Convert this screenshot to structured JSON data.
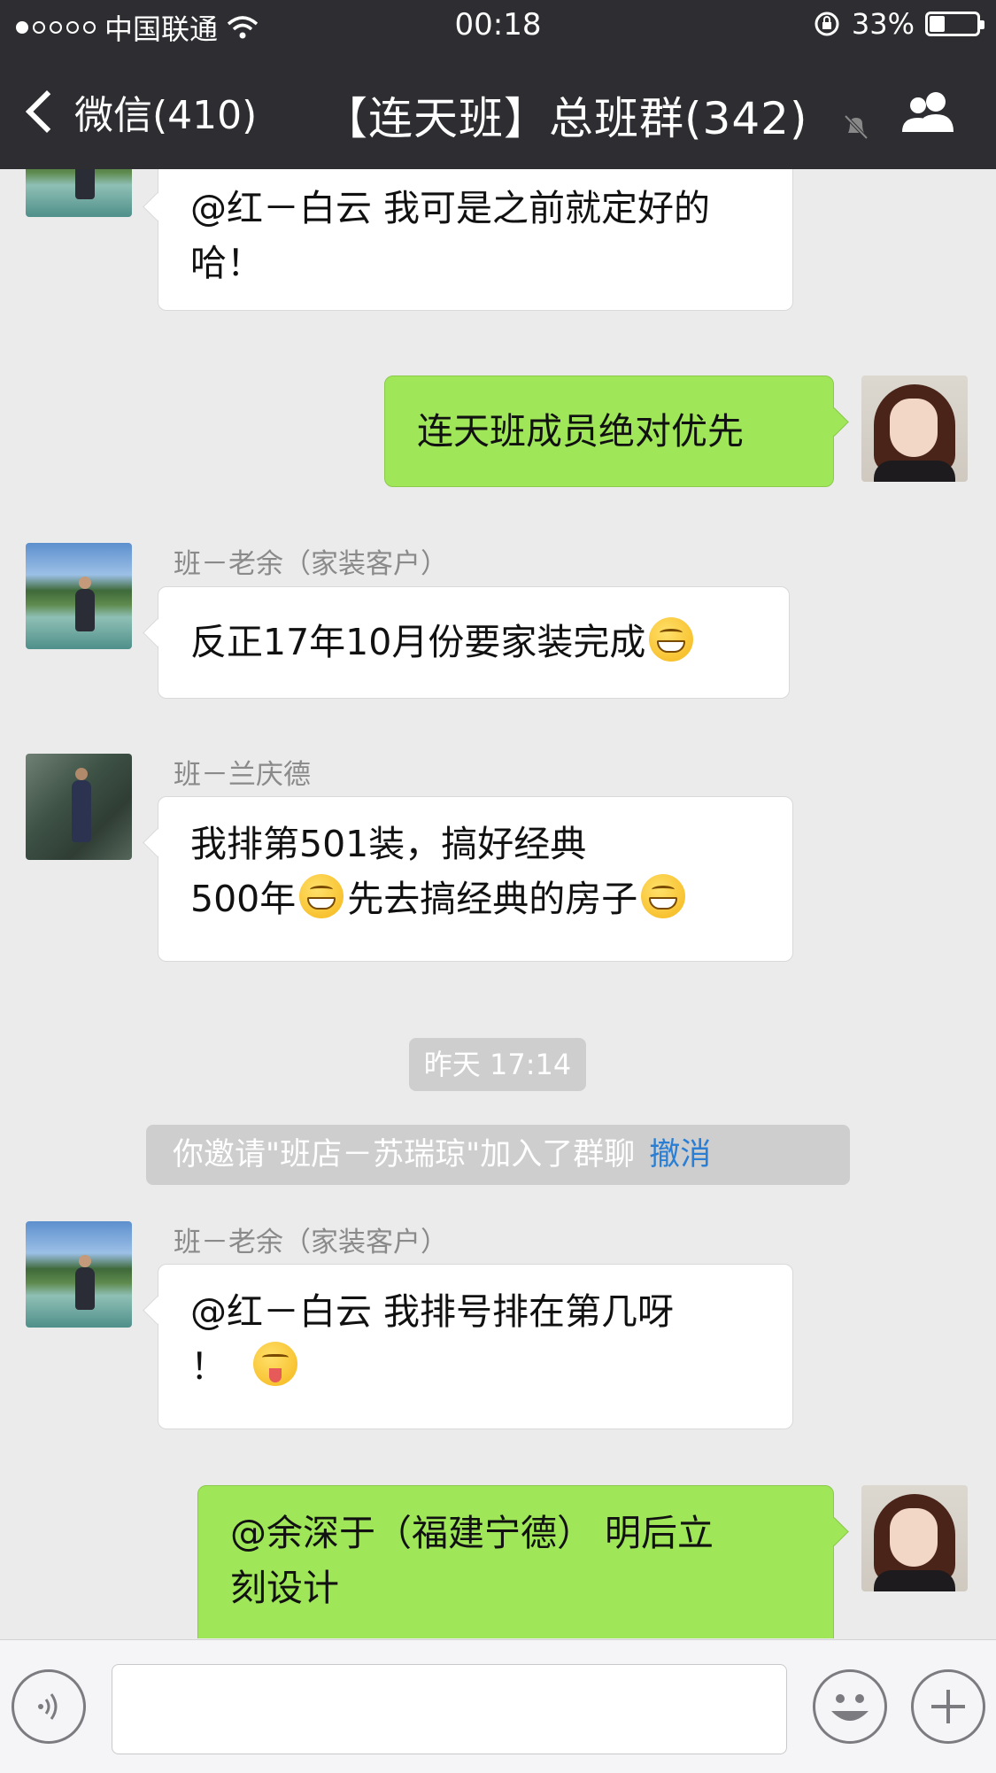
{
  "status_bar": {
    "carrier": "中国联通",
    "time": "00:18",
    "battery": "33%",
    "battery_level": 0.33
  },
  "nav": {
    "back_label": "微信(410)",
    "title": "【连天班】总班群(342)"
  },
  "messages": [
    {
      "side": "in",
      "sender": "",
      "text": "@红－白云 我可是之前就定好的哈！"
    },
    {
      "side": "out",
      "text": "连天班成员绝对优先"
    },
    {
      "side": "in",
      "sender": "班－老余（家装客户）",
      "text": "反正17年10月份要家装完成"
    },
    {
      "side": "in",
      "sender": "班－兰庆德",
      "text_line1": "我排第501装，搞好经典",
      "text_line2a": "500年",
      "text_line2b": "先去搞经典的房子"
    },
    {
      "side": "in",
      "sender": "班－老余（家装客户）",
      "text_line1": "@红－白云 我排号排在第几呀",
      "text_line2": "！"
    },
    {
      "side": "out",
      "text_line1": "@余深于（福建宁德） 明后立",
      "text_line2": "刻设计"
    }
  ],
  "timestamp": "昨天 17:14",
  "system_message": {
    "text": "你邀请\"班店－苏瑞琼\"加入了群聊",
    "action": "撤消"
  },
  "input": {
    "value": ""
  },
  "icons": {
    "back": "chevron-left-icon",
    "mute": "muted-bell-icon",
    "group": "group-members-icon",
    "voice": "voice-icon",
    "emoji": "emoji-icon",
    "add": "plus-icon"
  },
  "colors": {
    "nav_bg": "#2e2e32",
    "chat_bg": "#ebebeb",
    "out_bubble": "#9fe658",
    "in_bubble": "#ffffff",
    "link": "#2a7fd4"
  }
}
